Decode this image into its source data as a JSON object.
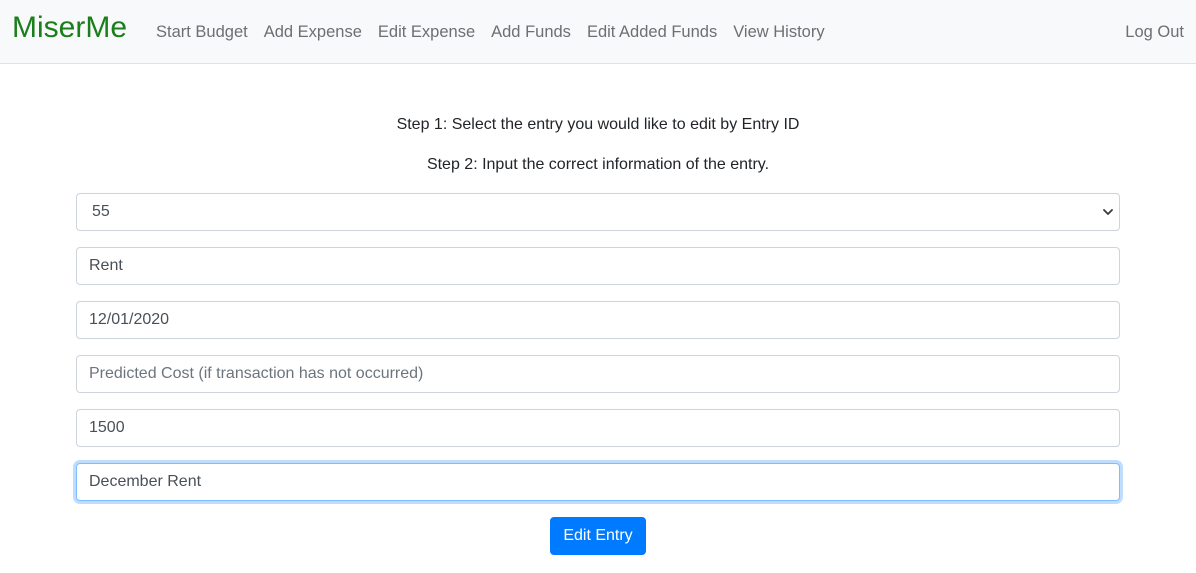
{
  "navbar": {
    "brand": "MiserMe",
    "links": [
      "Start Budget",
      "Add Expense",
      "Edit Expense",
      "Add Funds",
      "Edit Added Funds",
      "View History"
    ],
    "logout": "Log Out",
    "brand_color": "#1a7f1a"
  },
  "instructions": {
    "step1": "Step 1: Select the entry you would like to edit by Entry ID",
    "step2": "Step 2: Input the correct information of the entry."
  },
  "form": {
    "entry_id": {
      "value": "55"
    },
    "name": {
      "value": "Rent"
    },
    "date": {
      "value": "12/01/2020"
    },
    "predicted_cost": {
      "placeholder": "Predicted Cost (if transaction has not occurred)"
    },
    "actual_cost": {
      "value": "1500"
    },
    "notes": {
      "value": "December Rent"
    },
    "submit_label": "Edit Entry"
  },
  "colors": {
    "primary": "#007bff",
    "focus_border": "#80bdff"
  }
}
